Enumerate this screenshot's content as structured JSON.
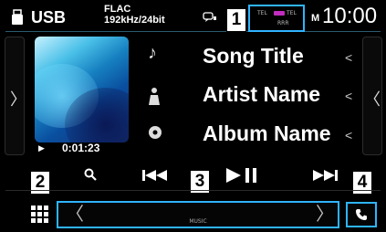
{
  "status": {
    "source": "USB",
    "format_line1": "FLAC",
    "format_line2": "192kHz/24bit",
    "indicator_line1": "TEL",
    "indicator_line2": "TEL",
    "indicator_line3": "RRR",
    "clock_suffix": "M",
    "clock": "10:00"
  },
  "track": {
    "title": "Song Title",
    "artist": "Artist Name",
    "album": "Album Name",
    "elapsed": "0:01:23"
  },
  "callouts": [
    "1",
    "2",
    "3",
    "4"
  ],
  "media_bar": {
    "label": "MUSIC"
  },
  "colors": {
    "accent": "#2fb4ff",
    "indicator": "#c22dbf",
    "background": "#000000"
  }
}
